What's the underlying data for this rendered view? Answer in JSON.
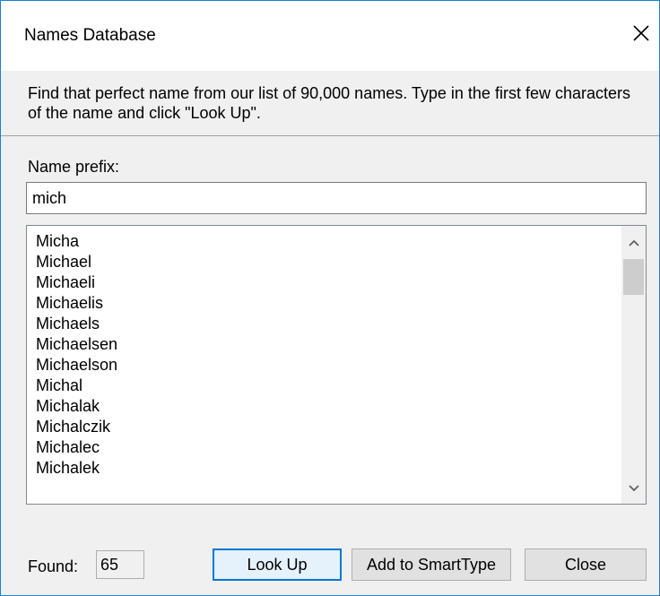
{
  "window": {
    "title": "Names Database"
  },
  "description": "Find that perfect name from our list of 90,000 names. Type in the first few characters of the name and click \"Look Up\".",
  "prefix": {
    "label": "Name prefix:",
    "value": "mich"
  },
  "results": {
    "items": [
      "Micha",
      "Michael",
      "Michaeli",
      "Michaelis",
      "Michaels",
      "Michaelsen",
      "Michaelson",
      "Michal",
      "Michalak",
      "Michalczik",
      "Michalec",
      "Michalek"
    ],
    "scroll_fraction": 0.0
  },
  "found": {
    "label": "Found:",
    "count": "65"
  },
  "buttons": {
    "lookup": "Look Up",
    "add_smarttype": "Add to SmartType",
    "close": "Close"
  },
  "icons": {
    "close": "close-icon",
    "scroll_up": "chevron-up-icon",
    "scroll_down": "chevron-down-icon"
  },
  "colors": {
    "window_border": "#1883d7",
    "dialog_bg": "#f0f0f0",
    "default_button_border": "#0078d7"
  }
}
